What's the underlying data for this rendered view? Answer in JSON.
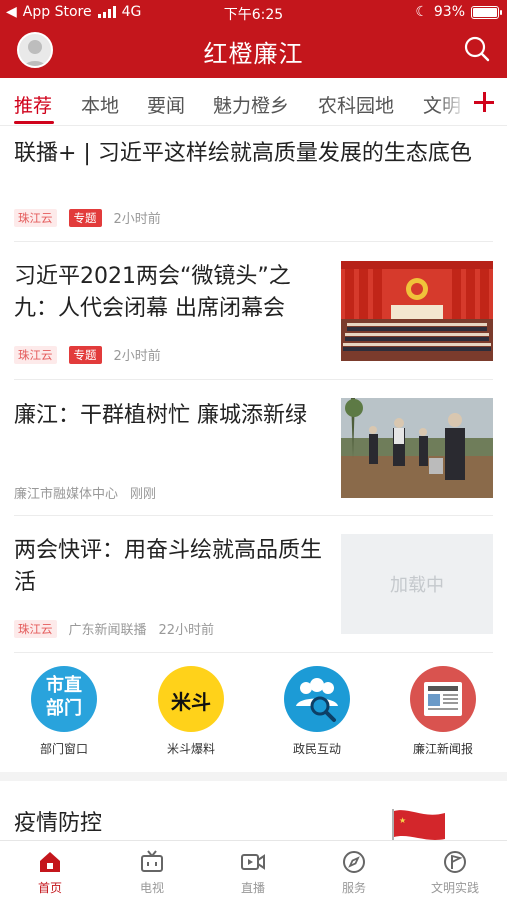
{
  "status_bar": {
    "carrier": "App Store",
    "network": "4G",
    "time": "下午6:25",
    "battery": "93%",
    "battery_level": 0.93
  },
  "header": {
    "title": "红橙廉江",
    "avatar_icon": "user-avatar-icon",
    "search_icon": "search-icon"
  },
  "tabs": [
    {
      "label": "推荐"
    },
    {
      "label": "本地"
    },
    {
      "label": "要闻"
    },
    {
      "label": "魅力橙乡"
    },
    {
      "label": "农科园地"
    },
    {
      "label": "文明"
    }
  ],
  "news": [
    {
      "title": "联播+ | 习近平这样绘就高质量发展的生态底色",
      "source": "珠江云",
      "topic": "专题",
      "time": "2小时前"
    },
    {
      "title": "习近平2021两会“微镜头”之九：人代会闭幕 出席闭幕会",
      "source": "珠江云",
      "topic": "专题",
      "time": "2小时前"
    },
    {
      "title": "廉江：干群植树忙 廉城添新绿",
      "source": "廉江市融媒体中心",
      "time": "刚刚"
    },
    {
      "title": "两会快评：用奋斗绘就高品质生活",
      "source": "珠江云",
      "publisher": "广东新闻联播",
      "time": "22小时前",
      "thumb_text": "加载中"
    }
  ],
  "quick_links": [
    {
      "label": "部门窗口",
      "icon_text": [
        "市直",
        "部门"
      ],
      "color": "#29a3dc"
    },
    {
      "label": "米斗爆料",
      "icon_text": [
        "米斗"
      ],
      "color": "#ffd21a"
    },
    {
      "label": "政民互动",
      "icon": "people-search-icon",
      "color": "#1c9bd6"
    },
    {
      "label": "廉江新闻报",
      "icon": "newspaper-icon",
      "color": "#d9534f"
    }
  ],
  "section": {
    "title": "疫情防控"
  },
  "tabbar": [
    {
      "label": "首页",
      "icon": "home-icon",
      "active": true
    },
    {
      "label": "电视",
      "icon": "tv-icon"
    },
    {
      "label": "直播",
      "icon": "live-video-icon"
    },
    {
      "label": "服务",
      "icon": "compass-icon"
    },
    {
      "label": "文明实践",
      "icon": "flag-circle-icon"
    }
  ],
  "colors": {
    "brand": "#c4161c",
    "accent": "#d0021b"
  }
}
